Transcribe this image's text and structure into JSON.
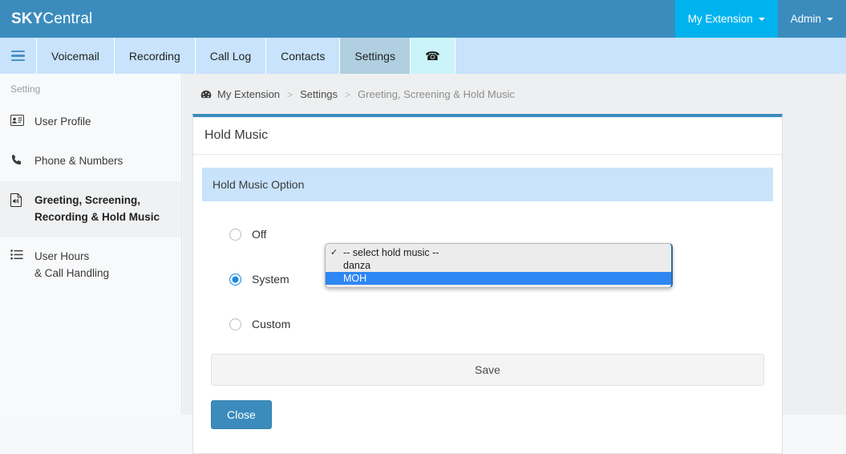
{
  "header": {
    "brand_bold": "SKY",
    "brand_light": "Central",
    "items": [
      {
        "label": "My Extension",
        "icon": "caret-down-icon",
        "active": true
      },
      {
        "label": "Admin",
        "icon": "caret-down-icon",
        "active": false
      }
    ]
  },
  "nav": {
    "burger_icon": "hamburger-menu-icon",
    "items": [
      {
        "label": "Voicemail",
        "active": false
      },
      {
        "label": "Recording",
        "active": false
      },
      {
        "label": "Call Log",
        "active": false
      },
      {
        "label": "Contacts",
        "active": false
      },
      {
        "label": "Settings",
        "active": true
      }
    ],
    "phone_tab": {
      "icon": "phone-handset-icon",
      "label": ""
    }
  },
  "sidebar": {
    "title": "Setting",
    "items": [
      {
        "label": "User Profile",
        "label_line2": "",
        "icon": "id-card-icon",
        "active": false
      },
      {
        "label": "Phone & Numbers",
        "label_line2": "",
        "icon": "phone-handset-icon",
        "active": false
      },
      {
        "label": "Greeting, Screening,",
        "label_line2": "Recording & Hold Music",
        "icon": "audio-file-icon",
        "active": true
      },
      {
        "label": "User Hours",
        "label_line2": "& Call Handling",
        "icon": "list-icon",
        "active": false
      }
    ]
  },
  "breadcrumb": {
    "icon": "dashboard-icon",
    "root": "My Extension",
    "sep": ">",
    "middle": "Settings",
    "current": "Greeting, Screening & Hold Music"
  },
  "panel": {
    "title": "Hold Music",
    "section_header": "Hold Music Option",
    "options": [
      {
        "label": "Off",
        "selected": false
      },
      {
        "label": "System",
        "selected": true
      },
      {
        "label": "Custom",
        "selected": false
      }
    ],
    "save_label": "Save",
    "close_label": "Close"
  },
  "dropdown": {
    "open": true,
    "check_glyph": "✓",
    "items": [
      {
        "label": "-- select hold music --",
        "checked": true,
        "highlighted": false
      },
      {
        "label": "danza",
        "checked": false,
        "highlighted": false
      },
      {
        "label": "MOH",
        "checked": false,
        "highlighted": true
      }
    ]
  },
  "colors": {
    "header_blue": "#3b8cbd",
    "accent_cyan": "#00b3ee",
    "nav_light_blue": "#c8e3fb",
    "nav_active": "#b0cfe0",
    "phone_tab": "#caf4fa",
    "section_blue": "#c8e3fb",
    "radio_on": "#1a8ae5",
    "dropdown_highlight": "#2f87f3"
  }
}
